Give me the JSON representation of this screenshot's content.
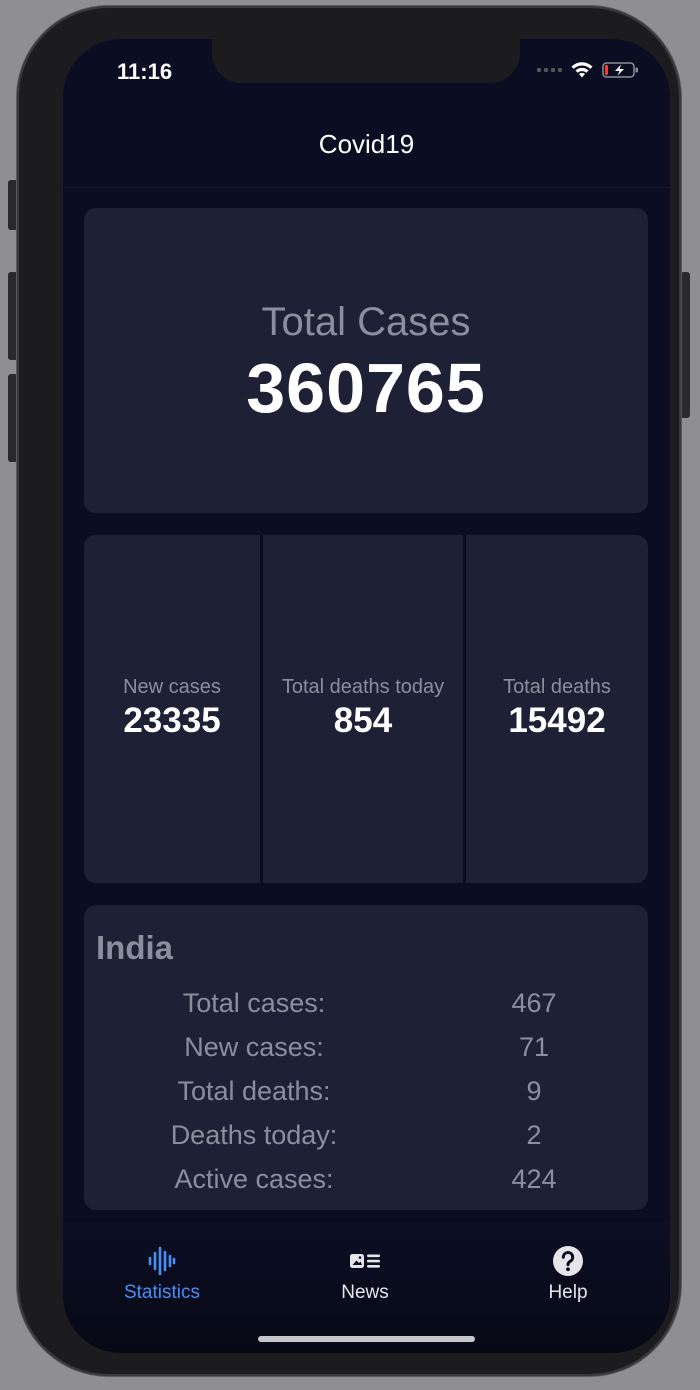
{
  "status_bar": {
    "time": "11:16"
  },
  "nav": {
    "title": "Covid19"
  },
  "global": {
    "total_cases_label": "Total Cases",
    "total_cases_value": "360765",
    "stats": [
      {
        "label": "New cases",
        "value": "23335"
      },
      {
        "label": "Total deaths today",
        "value": "854"
      },
      {
        "label": "Total deaths",
        "value": "15492"
      }
    ]
  },
  "country": {
    "name": "India",
    "rows": [
      {
        "label": "Total cases:",
        "value": "467"
      },
      {
        "label": "New cases:",
        "value": "71"
      },
      {
        "label": "Total deaths:",
        "value": "9"
      },
      {
        "label": "Deaths today:",
        "value": "2"
      },
      {
        "label": "Active cases:",
        "value": "424"
      }
    ]
  },
  "tabs": [
    {
      "label": "Statistics",
      "icon": "waveform-icon",
      "active": true
    },
    {
      "label": "News",
      "icon": "news-icon",
      "active": false
    },
    {
      "label": "Help",
      "icon": "help-icon",
      "active": false
    }
  ],
  "colors": {
    "accent": "#4a8ef5",
    "background": "#0b0e23",
    "card": "#1e2036",
    "muted_text": "#8d8e9d"
  }
}
